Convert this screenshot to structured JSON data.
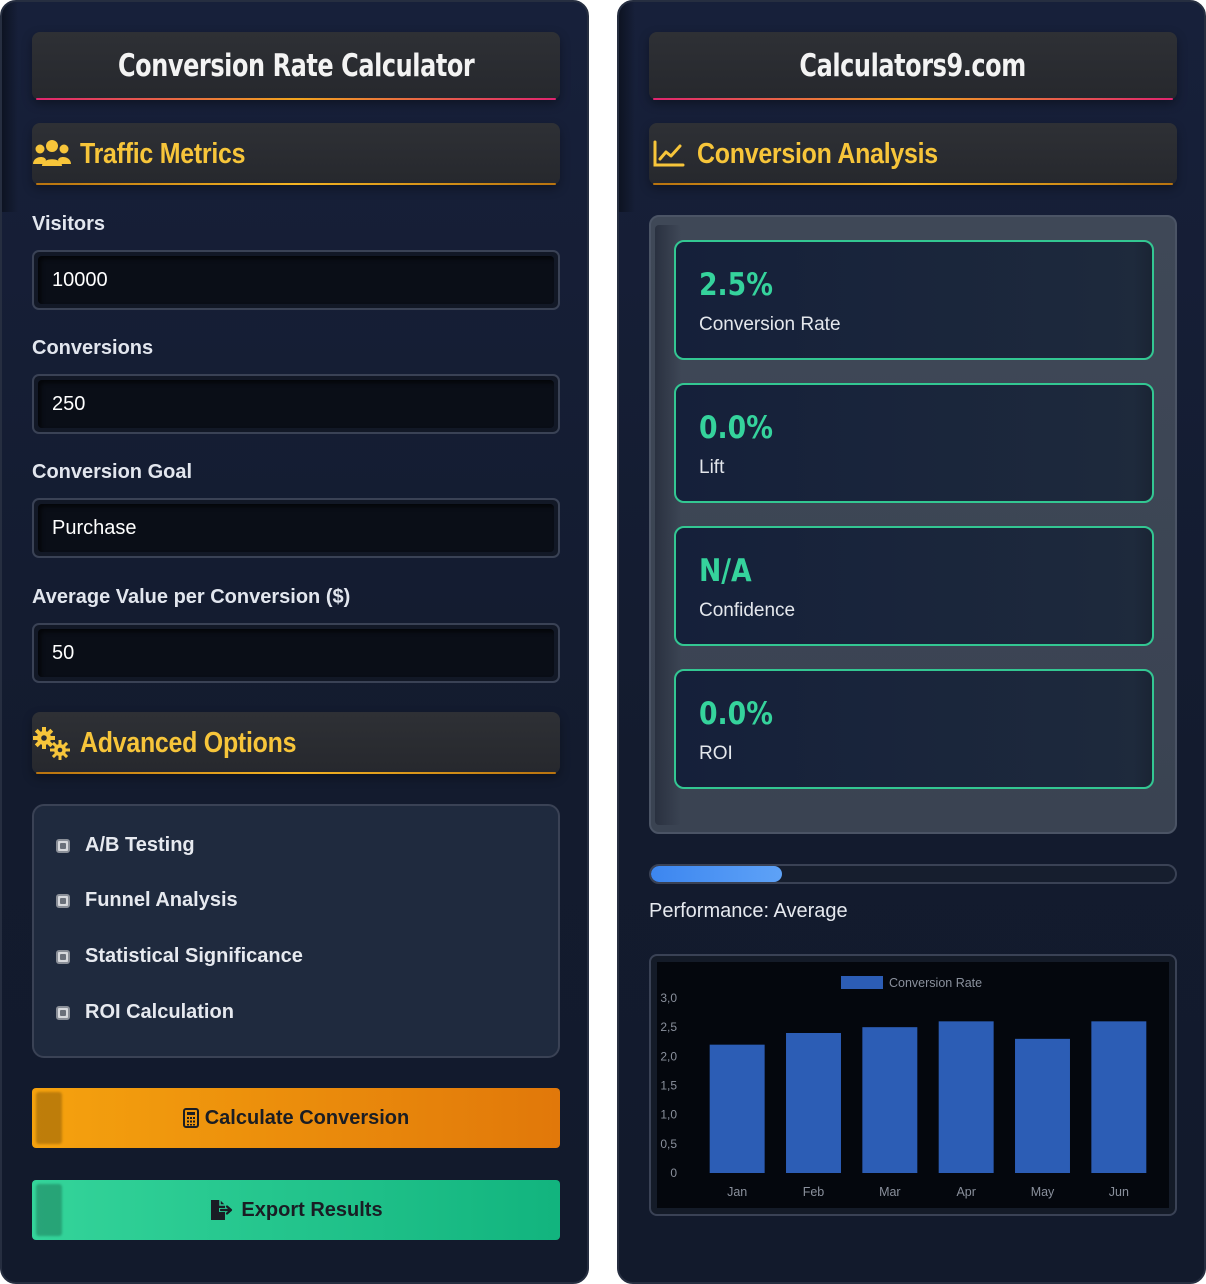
{
  "left": {
    "title": "Conversion Rate Calculator",
    "traffic_section": {
      "title": "Traffic Metrics",
      "icon": "users-icon"
    },
    "fields": [
      {
        "label": "Visitors",
        "value": "10000"
      },
      {
        "label": "Conversions",
        "value": "250"
      },
      {
        "label": "Conversion Goal",
        "value": "Purchase"
      },
      {
        "label": "Average Value per Conversion ($)",
        "value": "50"
      }
    ],
    "advanced_section": {
      "title": "Advanced Options",
      "icon": "gears-icon"
    },
    "options": [
      {
        "label": "A/B Testing"
      },
      {
        "label": "Funnel Analysis"
      },
      {
        "label": "Statistical Significance"
      },
      {
        "label": "ROI Calculation"
      }
    ],
    "calculate_button": {
      "label": "Calculate Conversion",
      "icon": "calculator-icon",
      "color": "#f5a20e"
    },
    "export_button": {
      "label": "Export Results",
      "icon": "file-export-icon",
      "color": "#1fc389"
    }
  },
  "right": {
    "title": "Calculators9.com",
    "analysis_section": {
      "title": "Conversion Analysis",
      "icon": "line-chart-icon"
    },
    "stats": [
      {
        "value": "2.5%",
        "label": "Conversion Rate"
      },
      {
        "value": "0.0%",
        "label": "Lift"
      },
      {
        "value": "N/A",
        "label": "Confidence"
      },
      {
        "value": "0.0%",
        "label": "ROI"
      }
    ],
    "performance": {
      "text": "Performance: Average",
      "level": 0.25
    },
    "accent_color": "#35d39c",
    "heading_color": "#f7c53a"
  },
  "chart_data": {
    "type": "bar",
    "categories": [
      "Jan",
      "Feb",
      "Mar",
      "Apr",
      "May",
      "Jun"
    ],
    "series": [
      {
        "name": "Conversion Rate",
        "values": [
          2.2,
          2.4,
          2.5,
          2.6,
          2.3,
          2.6
        ],
        "color": "#2c5db5"
      }
    ],
    "ylim": [
      0,
      3.0
    ],
    "yticks": [
      "0",
      "0,5",
      "1,0",
      "1,5",
      "2,0",
      "2,5",
      "3,0"
    ],
    "legend": "top-center",
    "grid": false
  }
}
